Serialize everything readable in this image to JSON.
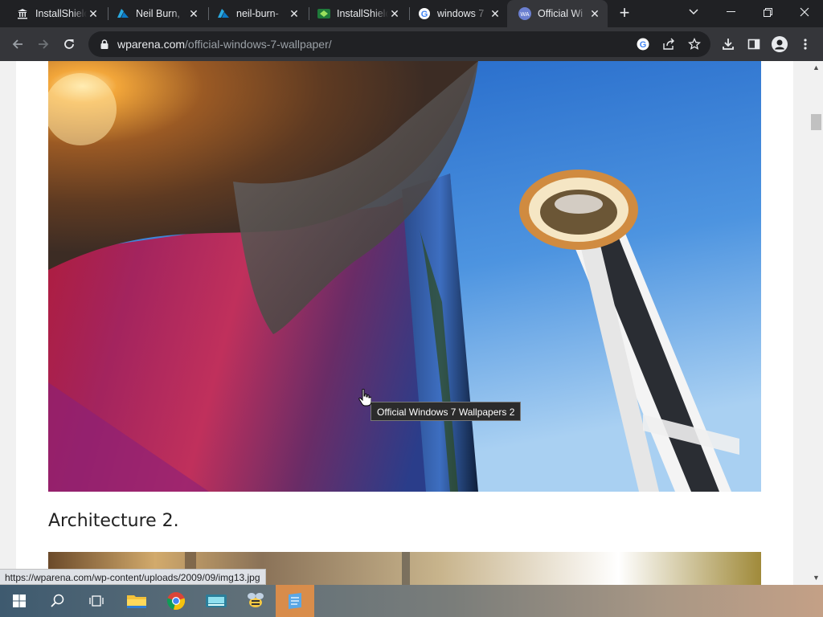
{
  "tabs": [
    {
      "title": "InstallShield",
      "icon": "pillar-icon"
    },
    {
      "title": "Neil Burn, ",
      "icon": "azure-icon"
    },
    {
      "title": "neil-burn-",
      "icon": "azure-icon"
    },
    {
      "title": "InstallShield",
      "icon": "installshield-icon"
    },
    {
      "title": "windows 7",
      "icon": "google-icon"
    },
    {
      "title": "Official Wi",
      "icon": "wparena-icon",
      "active": true
    }
  ],
  "address_bar": {
    "host": "wparena.com",
    "path": "/official-windows-7-wallpaper/"
  },
  "content": {
    "heading": "Architecture 2.",
    "tooltip": "Official Windows 7 Wallpapers 2"
  },
  "status_url": "https://wparena.com/wp-content/uploads/2009/09/img13.jpg",
  "taskbar_icons": [
    "windows-start-icon",
    "search-icon",
    "task-view-icon",
    "file-explorer-icon",
    "chrome-icon",
    "keyboard-app-icon",
    "bee-app-icon",
    "notepad-app-icon"
  ]
}
